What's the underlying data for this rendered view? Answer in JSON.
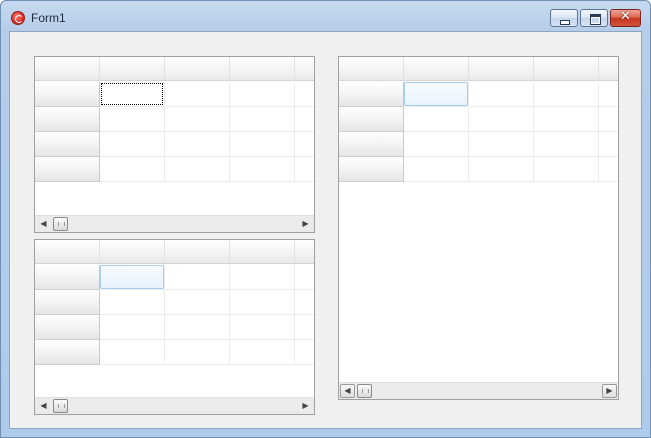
{
  "window": {
    "title": "Form1",
    "min_label": "",
    "max_label": "",
    "close_label": "✕"
  },
  "icons": {
    "app": "app-icon",
    "scroll_left": "◀",
    "scroll_right": "▶"
  },
  "grids": [
    {
      "name": "grid-top-left",
      "columns": 5,
      "rows": 4,
      "focus_cell": "dotted"
    },
    {
      "name": "grid-bottom-left",
      "columns": 5,
      "rows": 4,
      "focus_cell": "selected"
    },
    {
      "name": "grid-right",
      "columns": 5,
      "rows": 4,
      "focus_cell": "selected"
    }
  ],
  "colors": {
    "titlebar": "#b6cde9",
    "client": "#f0f0f0",
    "grid_border": "#a0a0a0",
    "close_button": "#c7361f",
    "selection": "#e9f3fd"
  }
}
